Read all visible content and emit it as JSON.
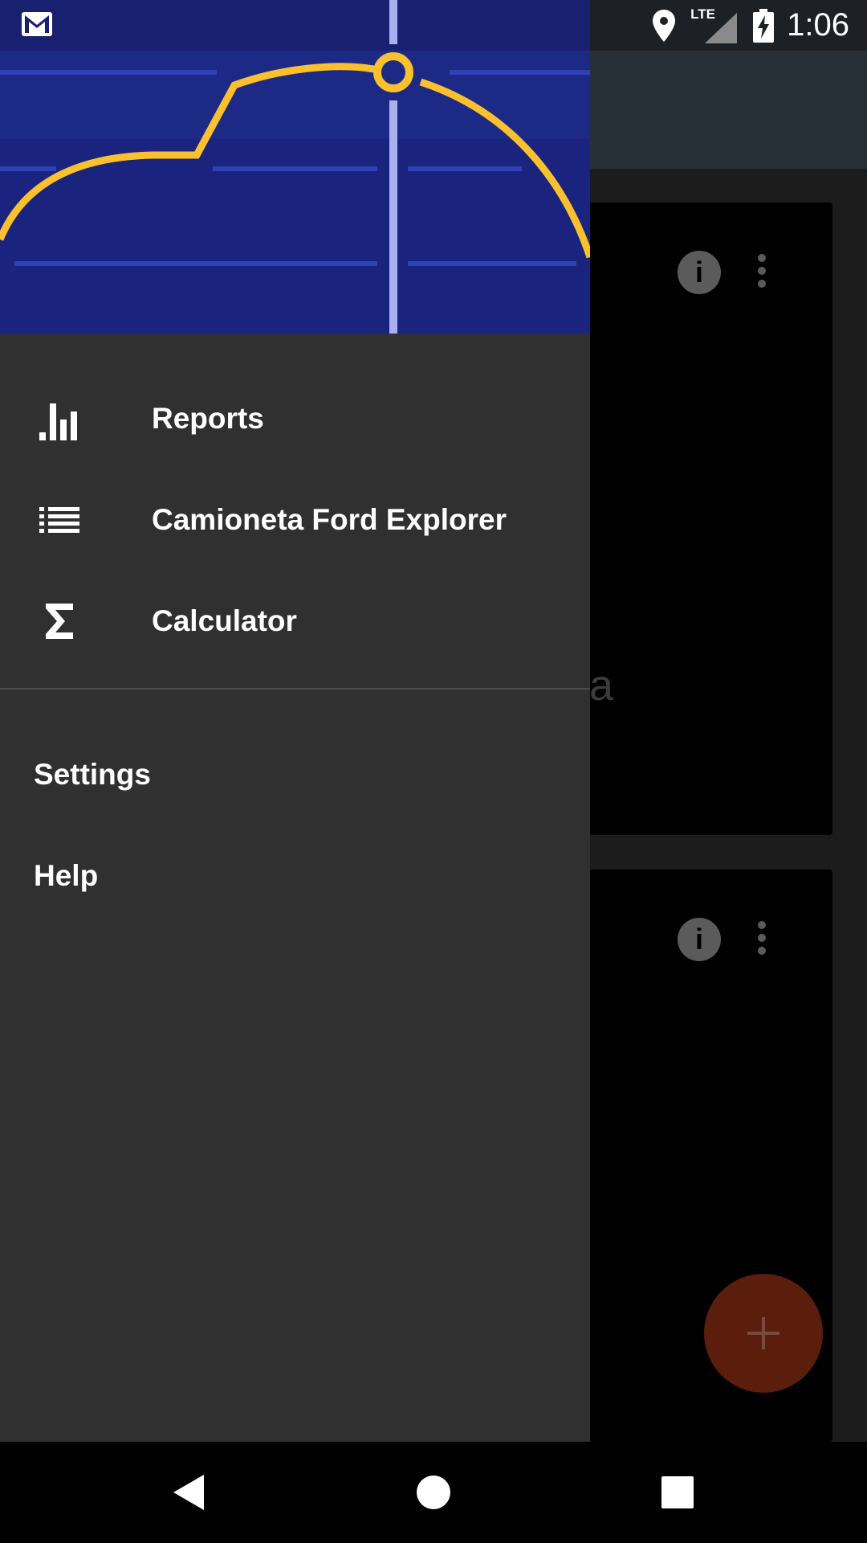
{
  "status_bar": {
    "network_label": "LTE",
    "time": "1:06",
    "icons": [
      "gmail-icon",
      "location-icon",
      "signal-icon",
      "battery-charging-icon"
    ]
  },
  "drawer": {
    "menu_items": [
      {
        "label": "Reports",
        "icon": "bar-chart-icon"
      },
      {
        "label": "Camioneta Ford Explorer",
        "icon": "list-icon"
      },
      {
        "label": "Calculator",
        "icon": "sigma-icon"
      }
    ],
    "secondary_items": [
      {
        "label": "Settings"
      },
      {
        "label": "Help"
      }
    ]
  },
  "background": {
    "card_partial_text": "a"
  },
  "colors": {
    "drawer_bg": "#303030",
    "header_blue": "#1a237e",
    "accent_yellow": "#fbc02d",
    "fab": "#5b1d0c"
  }
}
